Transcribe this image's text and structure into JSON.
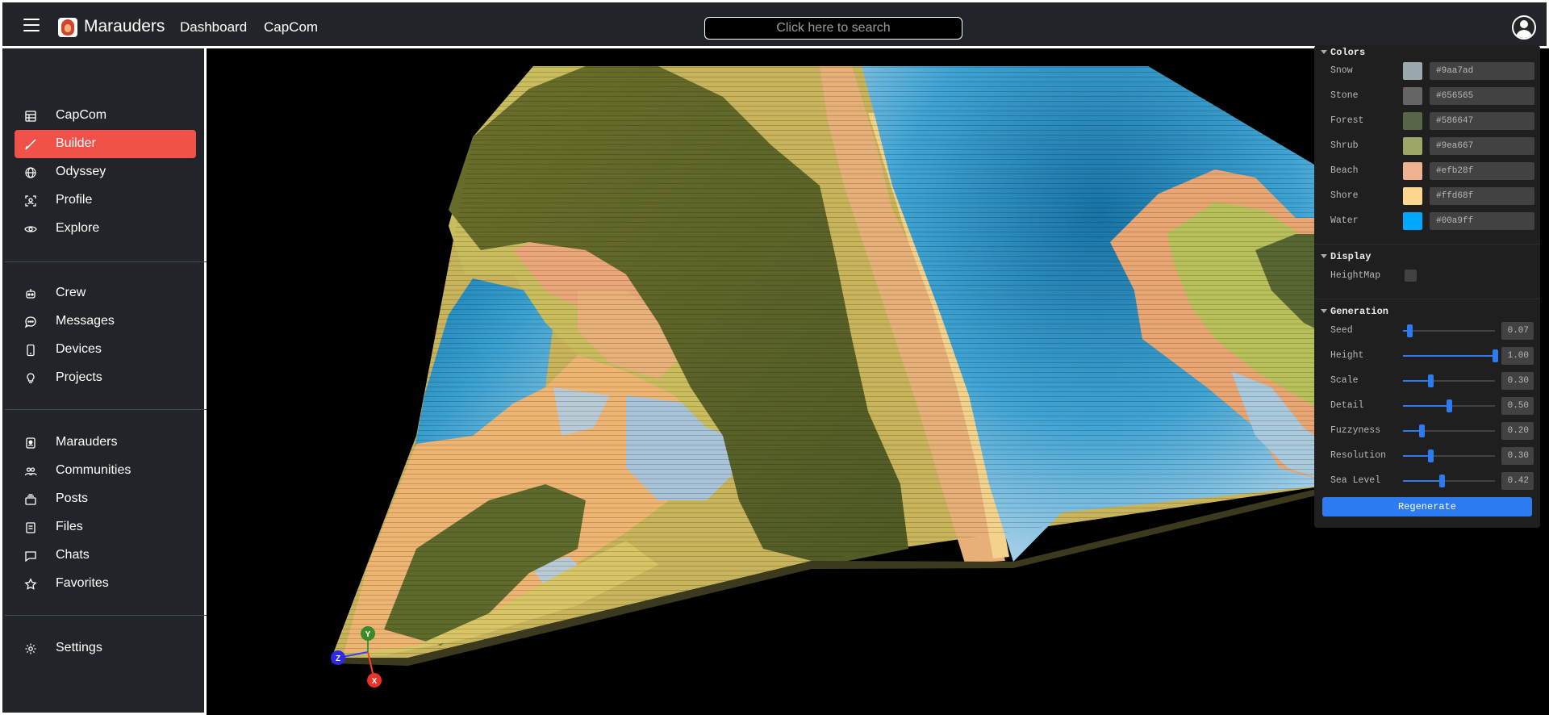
{
  "header": {
    "brand": "Marauders",
    "nav": [
      "Dashboard",
      "CapCom"
    ],
    "search_placeholder": "Click here to search"
  },
  "sidebar": {
    "groups": [
      [
        {
          "label": "CapCom",
          "icon": "table-icon"
        },
        {
          "label": "Builder",
          "icon": "brush-icon",
          "active": true
        },
        {
          "label": "Odyssey",
          "icon": "globe-icon"
        },
        {
          "label": "Profile",
          "icon": "profile-icon"
        },
        {
          "label": "Explore",
          "icon": "eye-icon"
        }
      ],
      [
        {
          "label": "Crew",
          "icon": "robot-icon"
        },
        {
          "label": "Messages",
          "icon": "chat-dots-icon"
        },
        {
          "label": "Devices",
          "icon": "phone-icon"
        },
        {
          "label": "Projects",
          "icon": "lightbulb-icon"
        }
      ],
      [
        {
          "label": "Marauders",
          "icon": "badge-icon"
        },
        {
          "label": "Communities",
          "icon": "people-icon"
        },
        {
          "label": "Posts",
          "icon": "stack-icon"
        },
        {
          "label": "Files",
          "icon": "file-icon"
        },
        {
          "label": "Chats",
          "icon": "chat-icon"
        },
        {
          "label": "Favorites",
          "icon": "star-icon"
        }
      ],
      [
        {
          "label": "Settings",
          "icon": "gear-icon"
        }
      ]
    ]
  },
  "gui": {
    "colors_title": "Colors",
    "colors": [
      {
        "label": "Snow",
        "hex": "#9aa7ad"
      },
      {
        "label": "Stone",
        "hex": "#656565"
      },
      {
        "label": "Forest",
        "hex": "#586647"
      },
      {
        "label": "Shrub",
        "hex": "#9ea667"
      },
      {
        "label": "Beach",
        "hex": "#efb28f"
      },
      {
        "label": "Shore",
        "hex": "#ffd68f"
      },
      {
        "label": "Water",
        "hex": "#00a9ff"
      }
    ],
    "display_title": "Display",
    "display": [
      {
        "label": "HeightMap",
        "checked": false
      }
    ],
    "generation_title": "Generation",
    "generation": [
      {
        "label": "Seed",
        "value": 0.07,
        "display": "0.07"
      },
      {
        "label": "Height",
        "value": 1.0,
        "display": "1.00"
      },
      {
        "label": "Scale",
        "value": 0.3,
        "display": "0.30"
      },
      {
        "label": "Detail",
        "value": 0.5,
        "display": "0.50"
      },
      {
        "label": "Fuzzyness",
        "value": 0.2,
        "display": "0.20"
      },
      {
        "label": "Resolution",
        "value": 0.3,
        "display": "0.30"
      },
      {
        "label": "Sea Level",
        "value": 0.42,
        "display": "0.42"
      }
    ],
    "regenerate_label": "Regenerate"
  },
  "axes_gizmo": {
    "x": "X",
    "y": "Y",
    "z": "Z"
  },
  "accent_color": "#f0524a"
}
